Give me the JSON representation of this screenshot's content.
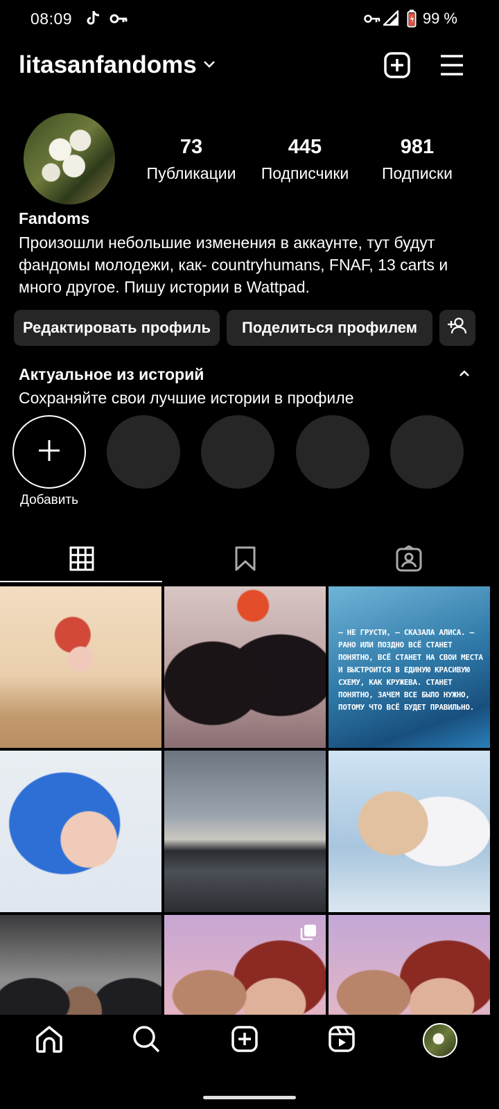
{
  "status_bar": {
    "time": "08:09",
    "battery": "99 %"
  },
  "header": {
    "username": "litasanfandoms"
  },
  "profile": {
    "stats": [
      {
        "value": "73",
        "label": "Публикации"
      },
      {
        "value": "445",
        "label": "Подписчики"
      },
      {
        "value": "981",
        "label": "Подписки"
      }
    ],
    "display_name": "Fandoms",
    "bio": "Произошли небольшие изменения в аккаунте, тут будут фандомы молодежи, как- countryhumans, FNAF, 13 carts и много другое. Пишу истории в Wattpad."
  },
  "buttons": {
    "edit": "Редактировать профиль",
    "share": "Поделиться профилем"
  },
  "highlights": {
    "title": "Актуальное из историй",
    "subtitle": "Сохраняйте свои лучшие истории в профиле",
    "add_label": "Добавить"
  },
  "posts": {
    "quote_text": "– НЕ ГРУСТИ, – СКАЗАЛА АЛИСА. – РАНО ИЛИ ПОЗДНО ВСЁ СТАНЕТ ПОНЯТНО, ВСЁ СТАНЕТ НА СВОИ МЕСТА И ВЫСТРОИТСЯ В ЕДИНУЮ КРАСИВУЮ СХЕМУ, КАК КРУЖЕВА. СТАНЕТ ПОНЯТНО, ЗАЧЕМ ВСЕ БЫЛО НУЖНО, ПОТОМУ ЧТО ВСЁ БУДЕТ ПРАВИЛЬНО."
  },
  "icons": {
    "status": [
      "tiktok-icon",
      "key-icon",
      "vpn-key-icon",
      "signal-icon",
      "battery-icon"
    ],
    "header": [
      "chevron-down-icon",
      "new-post-icon",
      "menu-icon"
    ],
    "tabs": [
      "grid-icon",
      "bookmark-icon",
      "tagged-icon"
    ],
    "nav": [
      "home-icon",
      "search-icon",
      "create-icon",
      "reels-icon",
      "profile-avatar"
    ]
  }
}
